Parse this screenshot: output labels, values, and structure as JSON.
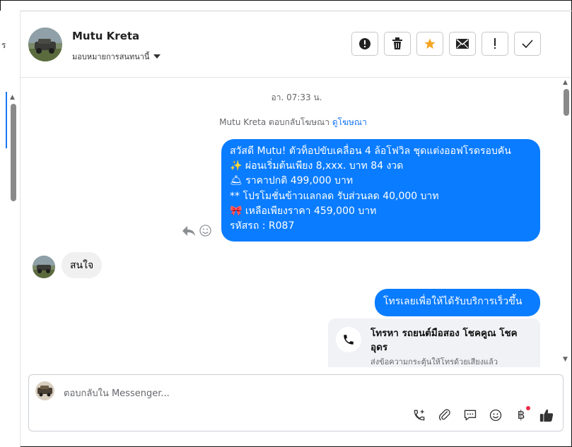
{
  "left_fragment": "ร",
  "header": {
    "name": "Mutu Kreta",
    "assign_label": "มอบหมายการสนทนานี้",
    "actions": [
      "alert-circle-icon",
      "trash-icon",
      "star-icon",
      "mail-icon",
      "exclamation-icon",
      "check-icon"
    ]
  },
  "chat": {
    "timestamp": "อา. 07:33 น.",
    "ad_reply_text": "Mutu Kreta ตอบกลับโฆษณา",
    "ad_link": "ดูโฆษณา",
    "outgoing_1": [
      "สวัสดี Mutu! ตัวท็อปขับเคลื่อน 4 ล้อโฟวิล ชุดแต่งออฟโรดรอบคัน",
      "✨  ผ่อนเริ่มต้นเพียง 8,xxx. บาท 84 งวด",
      "🛎 ราคาปกติ 499,000 บาท",
      "** โปรโมชั่นข้าวแลกลด รับส่วนลด 40,000 บาท",
      "🎀  เหลือเพียงราคา 459,000 บาท",
      " รหัสรถ : R087"
    ],
    "incoming_1": "สนใจ",
    "outgoing_2": "โทรเลยเพื่อให้ได้รับบริการเร็วขึ้น",
    "call_card": {
      "title": "โทรหา รถยนต์มือสอง โชคคูณ โชค อุดร",
      "subtitle": "ส่งข้อความกระตุ้นให้โทรด้วยเสียงแล้ว"
    }
  },
  "composer": {
    "placeholder": "ตอบกลับใน Messenger...",
    "currency_symbol": "฿",
    "tools": [
      "phone-add-icon",
      "paperclip-icon",
      "comment-icon",
      "smiley-icon",
      "baht-icon",
      "thumbs-up-icon"
    ]
  },
  "colors": {
    "accent": "#0a7cff",
    "star": "#f5a623",
    "link": "#1877f2"
  }
}
